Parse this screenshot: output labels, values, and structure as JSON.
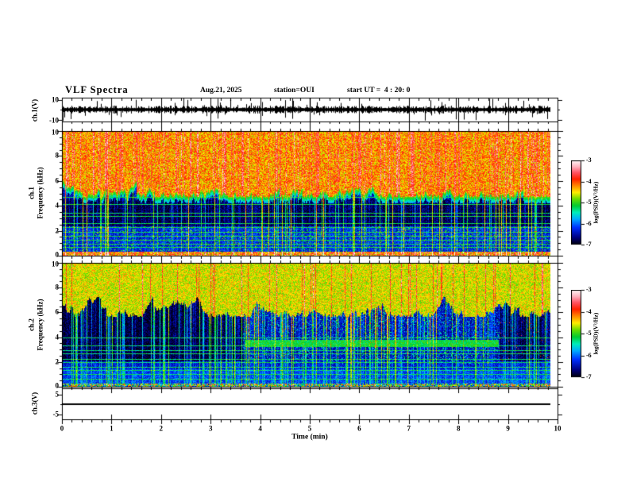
{
  "chart_data": {
    "type": "heatmap",
    "subtype": "vlf-multipanel-spectrogram",
    "title": "VLF Spectra",
    "date": "Aug.21, 2025",
    "station": "station=OUI",
    "start_ut": "start UT =  4 : 20: 0",
    "x": {
      "label": "Time (min)",
      "min": 0,
      "max": 10,
      "major_ticks": [
        0,
        1,
        2,
        3,
        4,
        5,
        6,
        7,
        8,
        9,
        10
      ],
      "minor_step": 0.2,
      "data_end_min": 9.85
    },
    "colorbar": {
      "label": "log(PSD)(V²/Hz)",
      "min": -7,
      "max": -3,
      "ticks": [
        -3,
        -4,
        -5,
        -6,
        -7
      ],
      "stops": [
        [
          0.0,
          "#000010"
        ],
        [
          0.08,
          "#000080"
        ],
        [
          0.2,
          "#0030ff"
        ],
        [
          0.3,
          "#00aaff"
        ],
        [
          0.38,
          "#00eebb"
        ],
        [
          0.46,
          "#00cc33"
        ],
        [
          0.54,
          "#66dd00"
        ],
        [
          0.62,
          "#ffee00"
        ],
        [
          0.7,
          "#ff8800"
        ],
        [
          0.78,
          "#ff2200"
        ],
        [
          0.86,
          "#ff5566"
        ],
        [
          0.93,
          "#ffb3c0"
        ],
        [
          1.0,
          "#fff6f6"
        ]
      ]
    },
    "panels": [
      {
        "id": "ch1_waveform",
        "kind": "timeseries",
        "ylabel": "ch.1(V)",
        "ymin": -10,
        "ymax": 10,
        "ytick_labels": [
          "10",
          "-10"
        ],
        "signal_description": "zero-mean broadband noise about ±2 V with impulsive sferic spikes reaching ±9 V"
      },
      {
        "id": "ch1_spectrogram",
        "kind": "spectrogram",
        "ylabel_lines": [
          "ch.1",
          "Frequency (kHz)"
        ],
        "ymin": 0,
        "ymax": 10,
        "ytick_values": [
          10,
          8,
          6,
          4,
          2,
          0
        ],
        "features": {
          "strong_band_khz": [
            6.5,
            10
          ],
          "strong_band_log_psd": [
            -4.6,
            -3.3
          ],
          "background_log_psd": -6.8,
          "hum_lines_khz": [
            4.65,
            4.1,
            3.4,
            3.1,
            2.55,
            2.2,
            1.85,
            1.5,
            1.2,
            0.9,
            0.65
          ],
          "low_speckle_band_khz": [
            0.3,
            2.3
          ],
          "bottom_band_khz": [
            0,
            0.3
          ],
          "vertical_sferic_streaks": "dense, full height, every few seconds"
        }
      },
      {
        "id": "ch2_spectrogram",
        "kind": "spectrogram",
        "ylabel_lines": [
          "ch.2",
          "Frequency (kHz)"
        ],
        "ymin": 0,
        "ymax": 10,
        "ytick_values": [
          10,
          8,
          6,
          4,
          2,
          0
        ],
        "features": {
          "strong_band_khz": [
            6.2,
            10
          ],
          "strong_band_log_psd": [
            -4.9,
            -3.8
          ],
          "dark_intervals_min": [
            [
              0,
              3.65
            ],
            [
              8.82,
              9.85
            ]
          ],
          "tone_band": {
            "khz": [
              3.15,
              3.72
            ],
            "minutes": [
              3.7,
              8.8
            ],
            "log_psd": -5.2
          },
          "hum_lines_khz": [
            3.9,
            3.3,
            2.9,
            2.6,
            2.2,
            1.9,
            1.55,
            1.3,
            0.95,
            0.6
          ],
          "bottom_band_khz": [
            0,
            0.25
          ]
        }
      },
      {
        "id": "ch3_timeseries",
        "kind": "timeseries",
        "ylabel": "ch.3(V)",
        "ytick_labels": [
          "5",
          "-5"
        ],
        "flat_value": 0
      }
    ]
  }
}
